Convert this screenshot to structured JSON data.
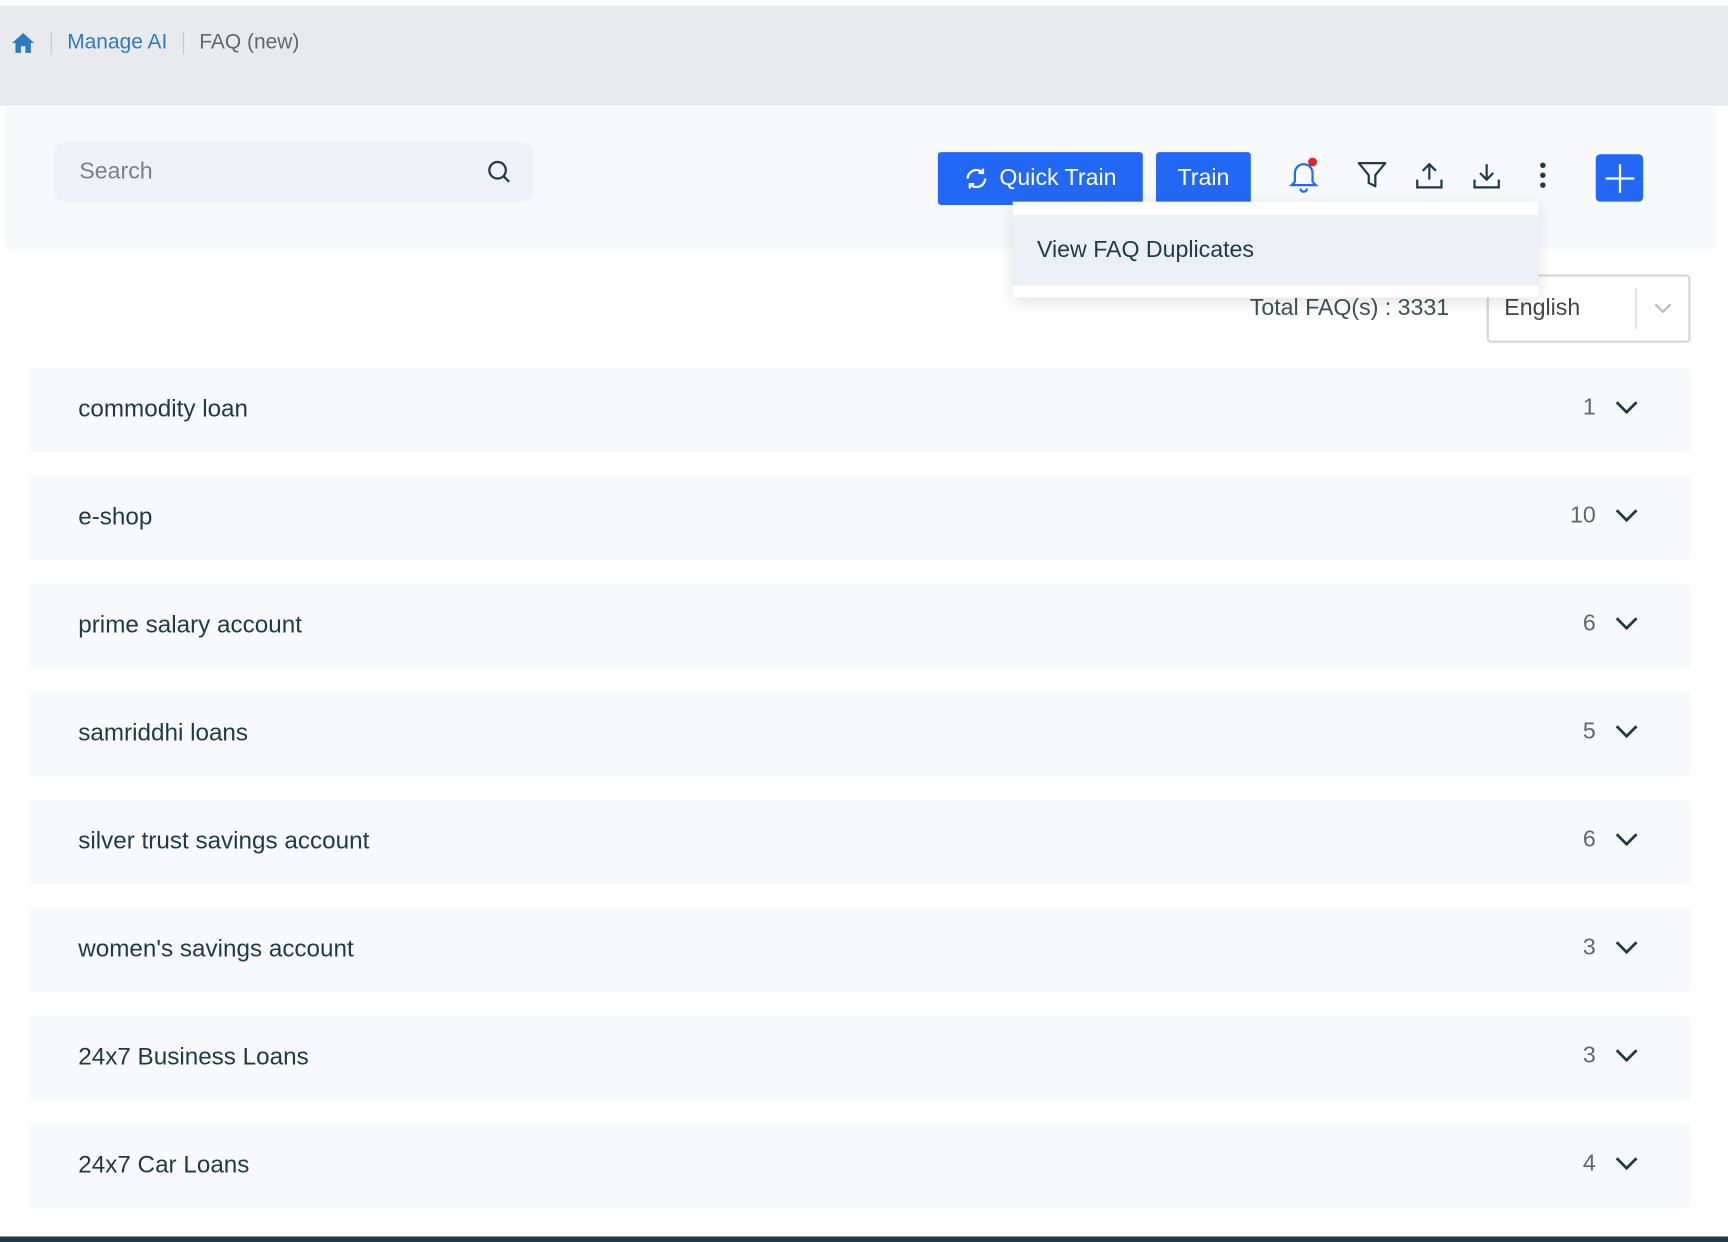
{
  "breadcrumb": {
    "home_icon": "home-icon",
    "items": [
      "Manage AI",
      "FAQ (new)"
    ]
  },
  "search": {
    "placeholder": "Search"
  },
  "toolbar": {
    "quick_train": "Quick Train",
    "train": "Train",
    "icons": [
      "refresh-icon",
      "bell-icon",
      "filter-icon",
      "upload-icon",
      "download-icon",
      "kebab-menu-icon",
      "plus-icon"
    ],
    "accent": "#2368f5",
    "notification_dot": "#e02424"
  },
  "menu": {
    "items": [
      "View FAQ Duplicates"
    ]
  },
  "summary": {
    "total": "Total FAQ(s) : 3331",
    "language": "English"
  },
  "categories": [
    {
      "name": "commodity loan",
      "count": "1"
    },
    {
      "name": "e-shop",
      "count": "10"
    },
    {
      "name": "prime salary account",
      "count": "6"
    },
    {
      "name": "samriddhi loans",
      "count": "5"
    },
    {
      "name": "silver trust savings account",
      "count": "6"
    },
    {
      "name": "women's savings account",
      "count": "3"
    },
    {
      "name": "24x7 Business Loans",
      "count": "3"
    },
    {
      "name": "24x7 Car Loans",
      "count": "4"
    }
  ]
}
